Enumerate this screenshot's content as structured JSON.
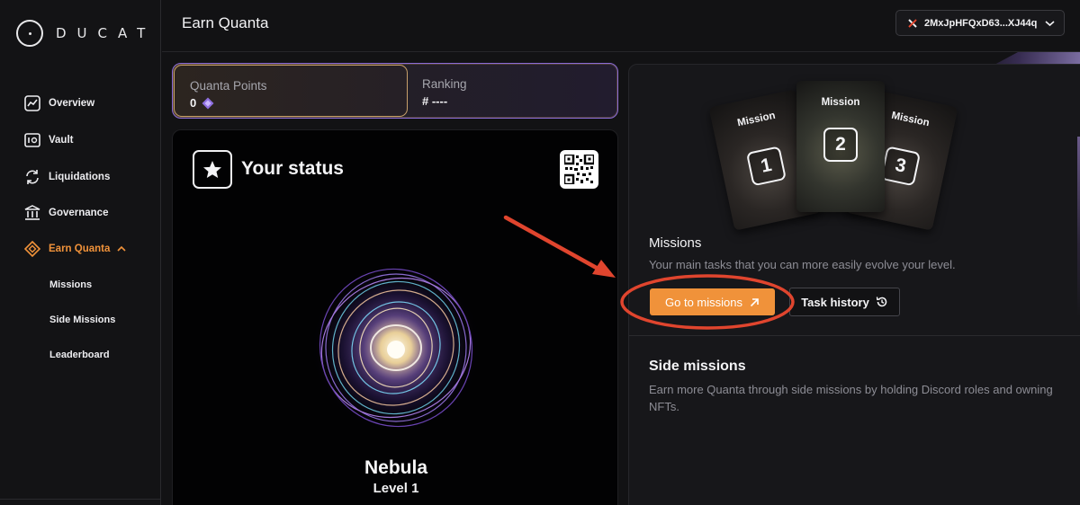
{
  "app": {
    "logo_text": "DUCAT"
  },
  "sidebar": {
    "items": [
      {
        "label": "Overview",
        "icon": "chart-line-icon"
      },
      {
        "label": "Vault",
        "icon": "vault-icon"
      },
      {
        "label": "Liquidations",
        "icon": "refresh-icon"
      },
      {
        "label": "Governance",
        "icon": "bank-icon"
      },
      {
        "label": "Earn Quanta",
        "icon": "diamond-icon"
      }
    ],
    "subitems": [
      {
        "label": "Missions"
      },
      {
        "label": "Side Missions"
      },
      {
        "label": "Leaderboard"
      }
    ]
  },
  "header": {
    "title": "Earn Quanta",
    "wallet_address": "2MxJpHFQxD63...XJ44q"
  },
  "points": {
    "quanta_label": "Quanta Points",
    "quanta_value": "0",
    "ranking_label": "Ranking",
    "ranking_value": "# ----"
  },
  "status": {
    "title": "Your status",
    "tier_name": "Nebula",
    "tier_level": "Level 1"
  },
  "missions_panel": {
    "cards": [
      {
        "title": "Mission",
        "number": "1"
      },
      {
        "title": "Mission",
        "number": "2"
      },
      {
        "title": "Mission",
        "number": "3"
      }
    ],
    "heading": "Missions",
    "description": "Your main tasks that you can more easily evolve your level.",
    "go_button": "Go to missions",
    "history_button": "Task history",
    "side_heading": "Side missions",
    "side_description": "Earn more Quanta through side missions by holding Discord roles and owning NFTs."
  },
  "colors": {
    "accent": "#f0923a",
    "background": "#121214",
    "annotation": "#e0452e"
  }
}
